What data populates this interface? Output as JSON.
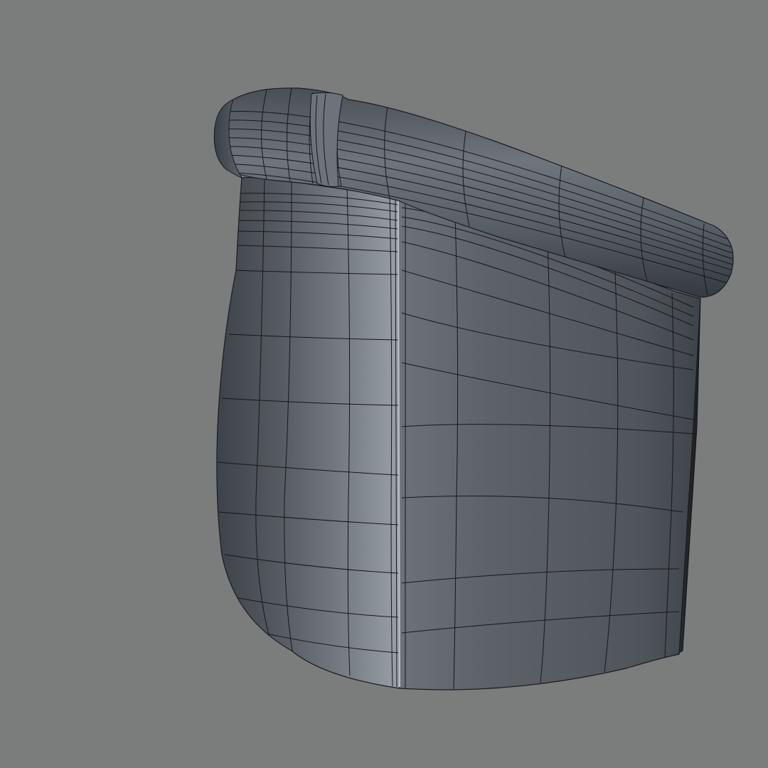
{
  "scene": {
    "background_color": "#7b7c7c",
    "object": "armchair-back-wireframe",
    "surface_color": "#5a5f66",
    "highlight_color": "#8c929a",
    "shadow_color": "#3c4047",
    "wire_color": "#15171a"
  }
}
